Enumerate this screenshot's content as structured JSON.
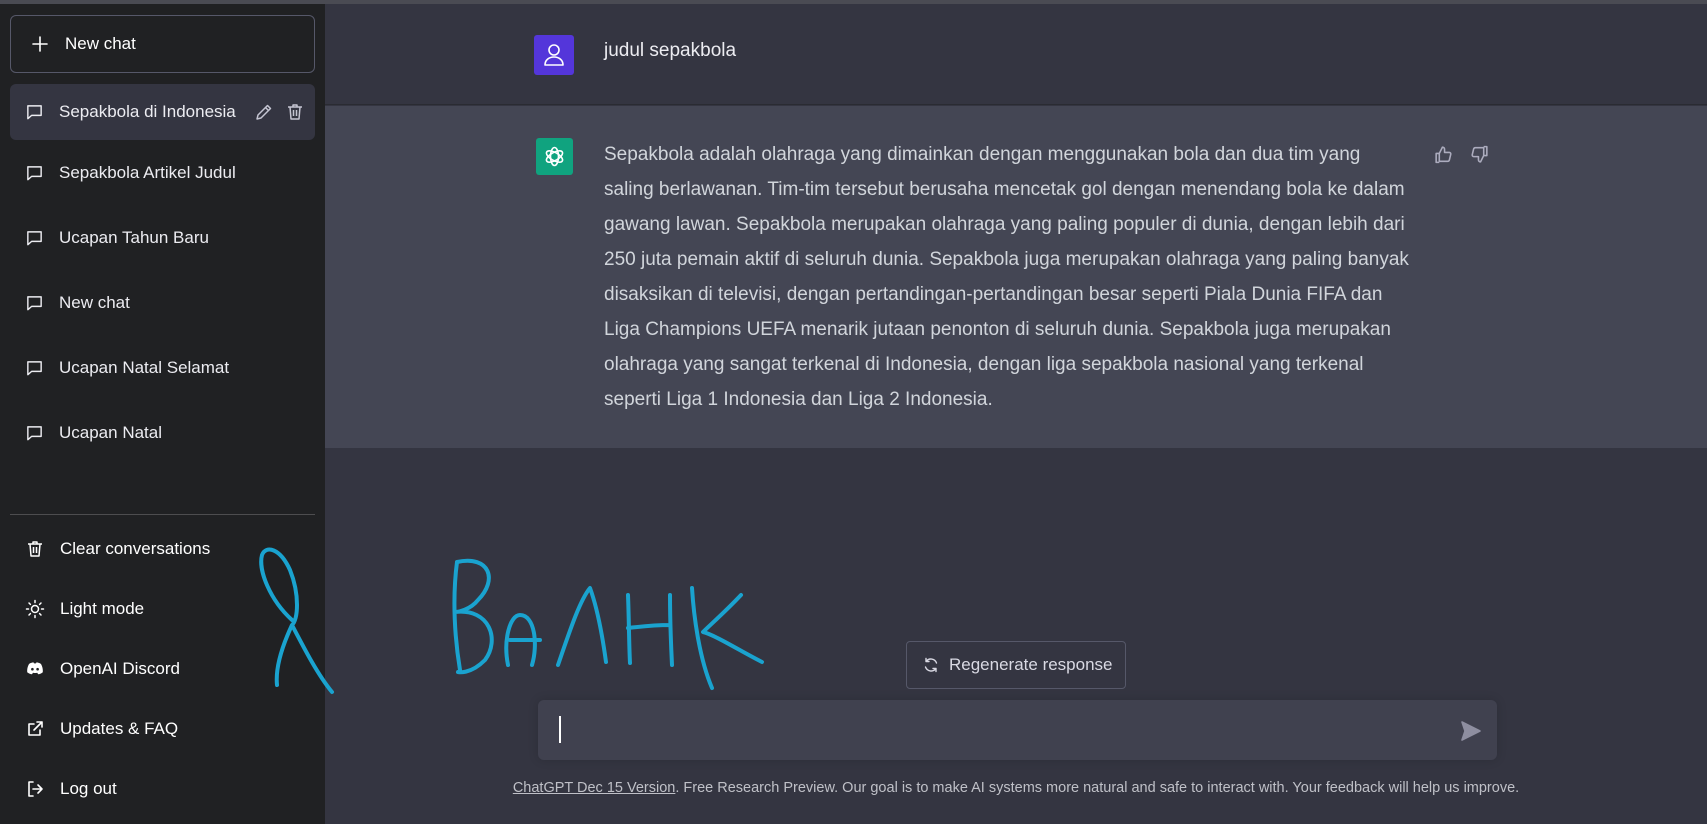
{
  "sidebar": {
    "new_chat_label": "New chat",
    "conversations": [
      {
        "label": "Sepakbola di Indonesia",
        "active": true
      },
      {
        "label": "Sepakbola Artikel Judul"
      },
      {
        "label": "Ucapan Tahun Baru"
      },
      {
        "label": "New chat"
      },
      {
        "label": "Ucapan Natal Selamat"
      },
      {
        "label": "Ucapan Natal"
      }
    ],
    "footer": {
      "clear": "Clear conversations",
      "light": "Light mode",
      "discord": "OpenAI Discord",
      "faq": "Updates & FAQ",
      "logout": "Log out"
    }
  },
  "chat": {
    "user_message": "judul sepakbola",
    "assistant_message": "Sepakbola adalah olahraga yang dimainkan dengan menggunakan bola dan dua tim yang saling berlawanan. Tim-tim tersebut berusaha mencetak gol dengan menendang bola ke dalam gawang lawan. Sepakbola merupakan olahraga yang paling populer di dunia, dengan lebih dari 250 juta pemain aktif di seluruh dunia. Sepakbola juga merupakan olahraga yang paling banyak disaksikan di televisi, dengan pertandingan-pertandingan besar seperti Piala Dunia FIFA dan Liga Champions UEFA menarik jutaan penonton di seluruh dunia. Sepakbola juga merupakan olahraga yang sangat terkenal di Indonesia, dengan liga sepakbola nasional yang terkenal seperti Liga 1 Indonesia dan Liga 2 Indonesia.",
    "regenerate_label": "Regenerate response",
    "input_value": "",
    "disclaimer_link": "ChatGPT Dec 15 Version",
    "disclaimer_text": ". Free Research Preview. Our goal is to make AI systems more natural and safe to interact with. Your feedback will help us improve."
  },
  "doodle": {
    "text": "Я Валик",
    "color": "#1aa3cf"
  },
  "colors": {
    "sidebar_bg": "#202123",
    "main_bg": "#343541",
    "assistant_bg": "#444654",
    "user_avatar": "#5436da",
    "assistant_avatar": "#10a37f"
  }
}
